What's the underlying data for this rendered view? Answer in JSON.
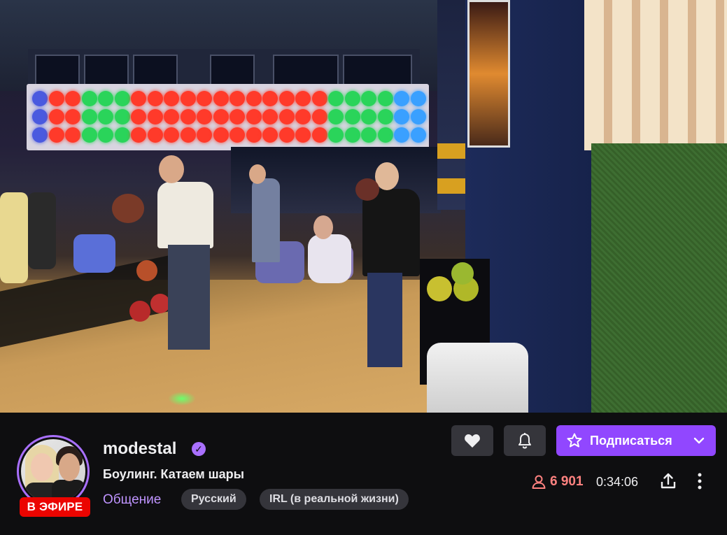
{
  "video": {
    "label": "live-video-player"
  },
  "channel": {
    "name": "modestal",
    "verified_icon": "check-badge-icon",
    "live_label": "В ЭФИРЕ",
    "avatar_icon": "channel-avatar"
  },
  "stream": {
    "title": "Боулинг. Катаем шары",
    "category": "Общение",
    "tags": [
      "Русский",
      "IRL (в реальной жизни)"
    ],
    "viewers": "6 901",
    "uptime": "0:34:06"
  },
  "actions": {
    "follow_icon": "heart-icon",
    "notify_icon": "bell-icon",
    "subscribe_label": "Подписаться",
    "share_icon": "share-icon",
    "more_icon": "more-vertical-icon"
  },
  "colors": {
    "accent": "#9147ff",
    "accent_text": "#bf94ff",
    "live": "#eb0400",
    "viewers": "#ff8280",
    "background": "#0e0e10",
    "tag_bg": "#35353b"
  }
}
